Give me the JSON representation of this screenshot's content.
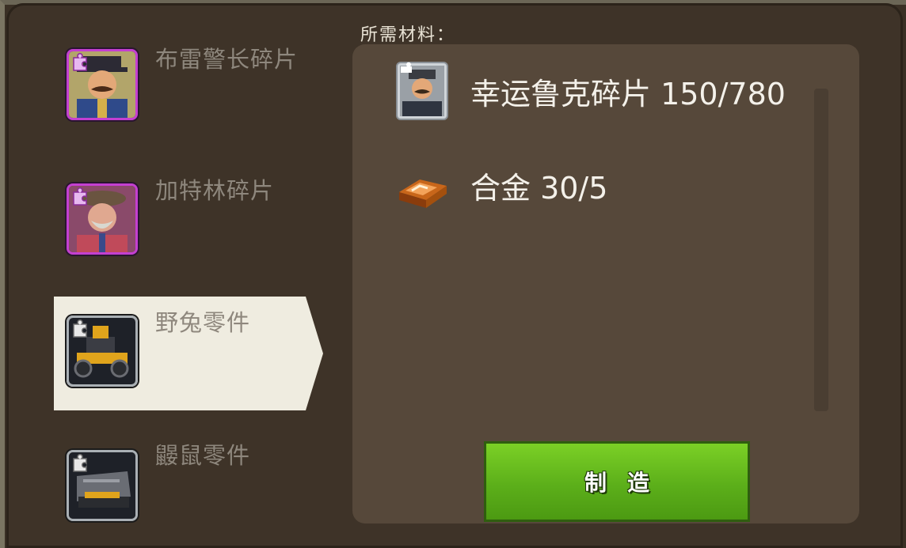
{
  "list": {
    "items": [
      {
        "label": "布雷警长碎片",
        "rarity": "purple"
      },
      {
        "label": "加特林碎片",
        "rarity": "purple"
      },
      {
        "label": "野兔零件",
        "rarity": "grey",
        "selected": true
      },
      {
        "label": "鼹鼠零件",
        "rarity": "grey"
      }
    ]
  },
  "materials": {
    "title": "所需材料：",
    "items": [
      {
        "name": "幸运鲁克碎片 150/780",
        "icon": "lucky-luke-fragment-icon"
      },
      {
        "name": "合金 30/5",
        "icon": "alloy-ingot-icon"
      }
    ]
  },
  "actions": {
    "craft_label": "制造"
  },
  "colors": {
    "accent_green": "#5caf1a",
    "selected_bg": "#efece0",
    "purple_rarity": "#c43fd1",
    "panel_bg": "#56483a"
  }
}
